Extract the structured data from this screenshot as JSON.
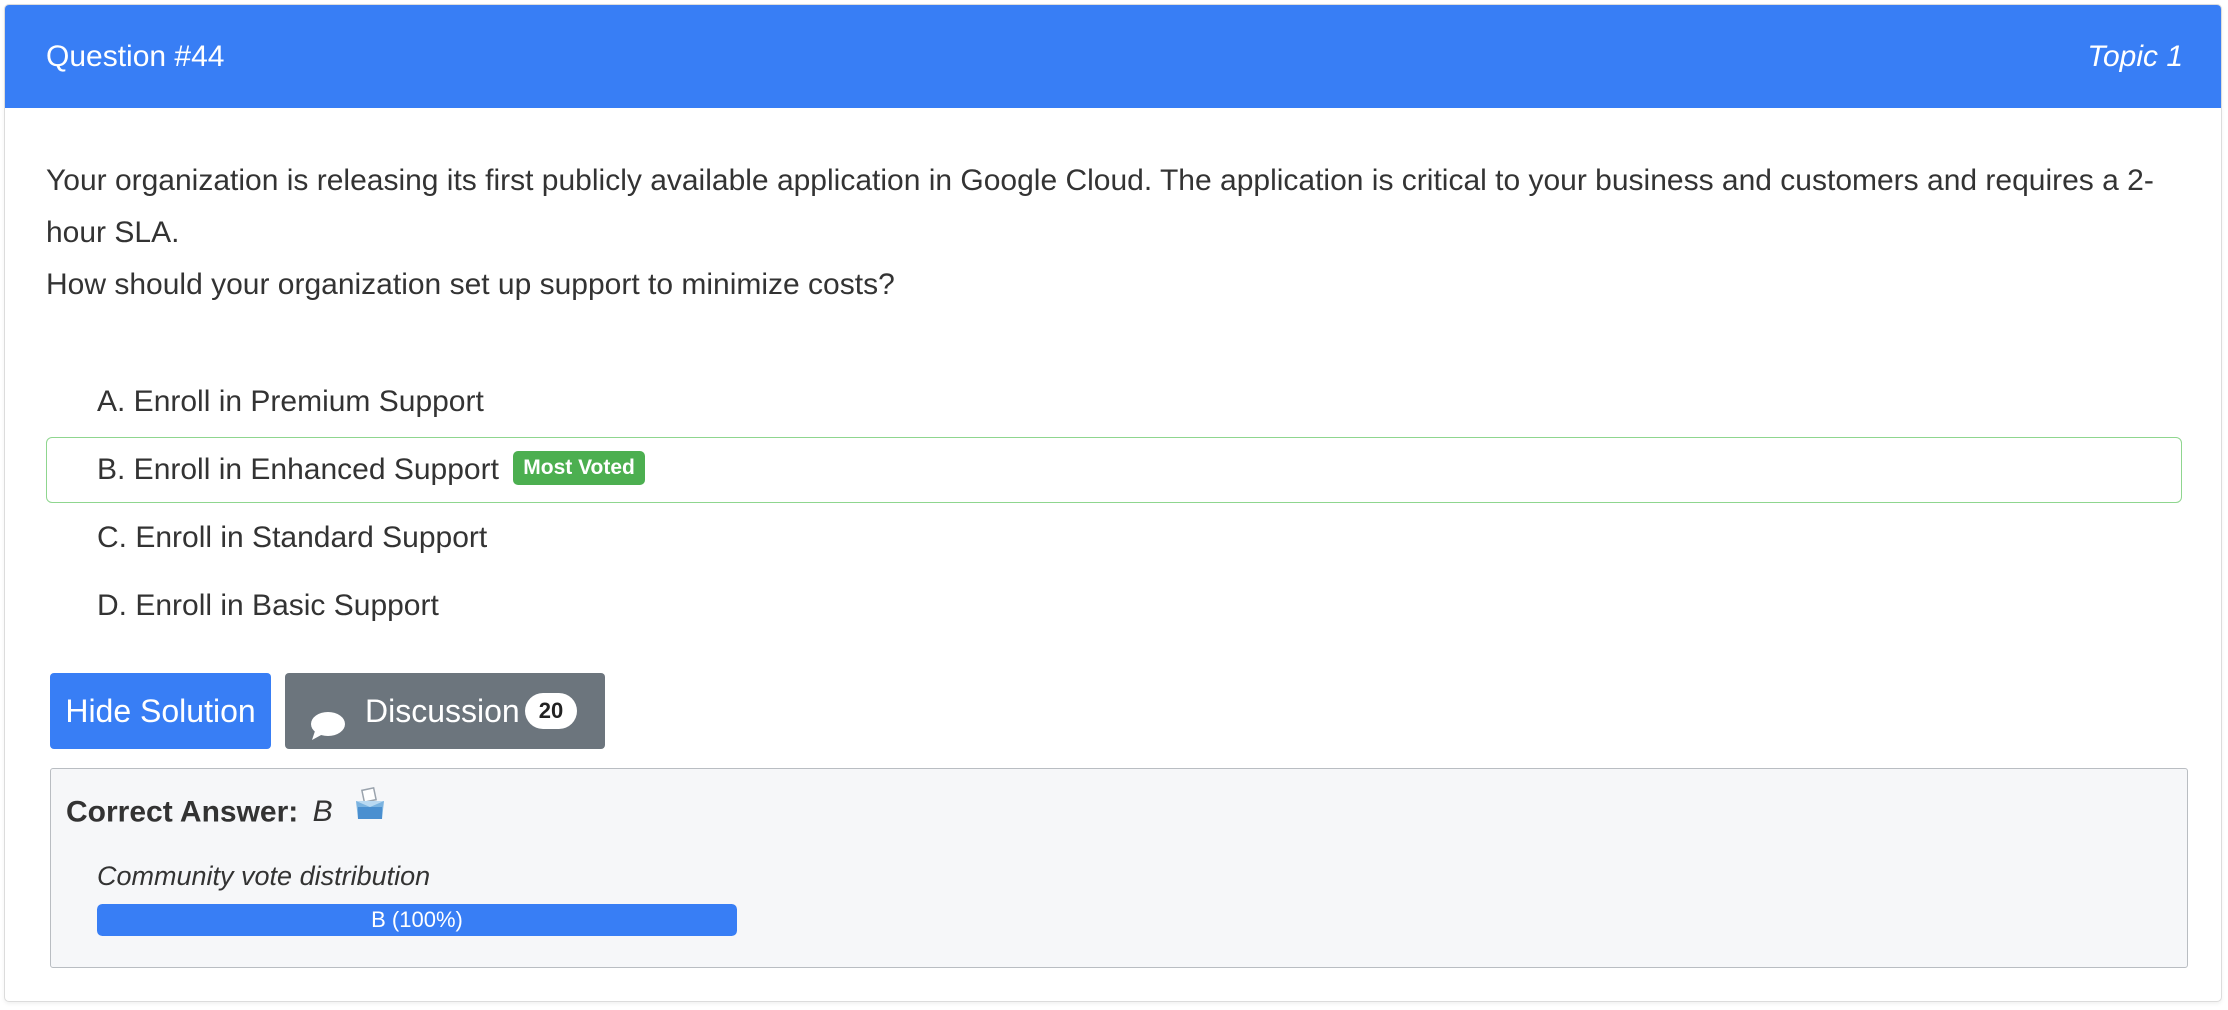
{
  "header": {
    "question_label": "Question #44",
    "topic_label": "Topic 1"
  },
  "question": {
    "text_line1": "Your organization is releasing its first publicly available application in Google Cloud. The application is critical to your business and customers and requires a 2- hour SLA.",
    "text_line2": "How should your organization set up support to minimize costs?"
  },
  "choices": [
    {
      "label": "A. Enroll in Premium Support"
    },
    {
      "label": "B. Enroll in Enhanced Support",
      "badge": "Most Voted"
    },
    {
      "label": "C. Enroll in Standard Support"
    },
    {
      "label": "D. Enroll in Basic Support"
    }
  ],
  "buttons": {
    "hide_solution": "Hide Solution",
    "discussion": "Discussion",
    "discussion_count": "20"
  },
  "answer": {
    "label": "Correct Answer:",
    "value": "B",
    "vote_title": "Community vote distribution",
    "vote_bar_text": "B (100%)",
    "vote_fraction": 1.0
  },
  "colors": {
    "primary": "#387ef5",
    "secondary": "#6c757d",
    "success": "#4caf50"
  },
  "icons": {
    "discussion": "speech-bubble-icon",
    "ballot": "ballot-box-icon"
  }
}
